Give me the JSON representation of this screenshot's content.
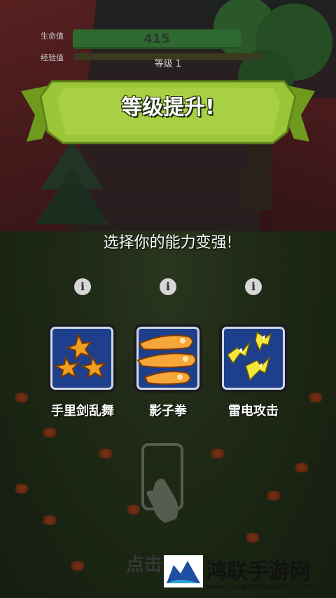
{
  "hud": {
    "hp_label": "生命值",
    "xp_label": "经验值",
    "hp_value": "415",
    "level_text": "等级 1",
    "xp_fraction": 0.0
  },
  "banner": {
    "title": "等级提升!"
  },
  "prompt": {
    "text": "选择你的能力变强!"
  },
  "skills": [
    {
      "label": "手里剑乱舞",
      "icon": "shuriken-icon"
    },
    {
      "label": "影子拳",
      "icon": "shadow-fist-icon"
    },
    {
      "label": "雷电攻击",
      "icon": "lightning-icon"
    }
  ],
  "hint": {
    "text": "点击"
  },
  "watermark": {
    "title": "鸿联手游网",
    "url": "www.henanhonglian95.com"
  },
  "colors": {
    "banner_green": "#9cc63a",
    "card_blue": "#1e3f8c",
    "hp_green": "#2e6a2f"
  }
}
